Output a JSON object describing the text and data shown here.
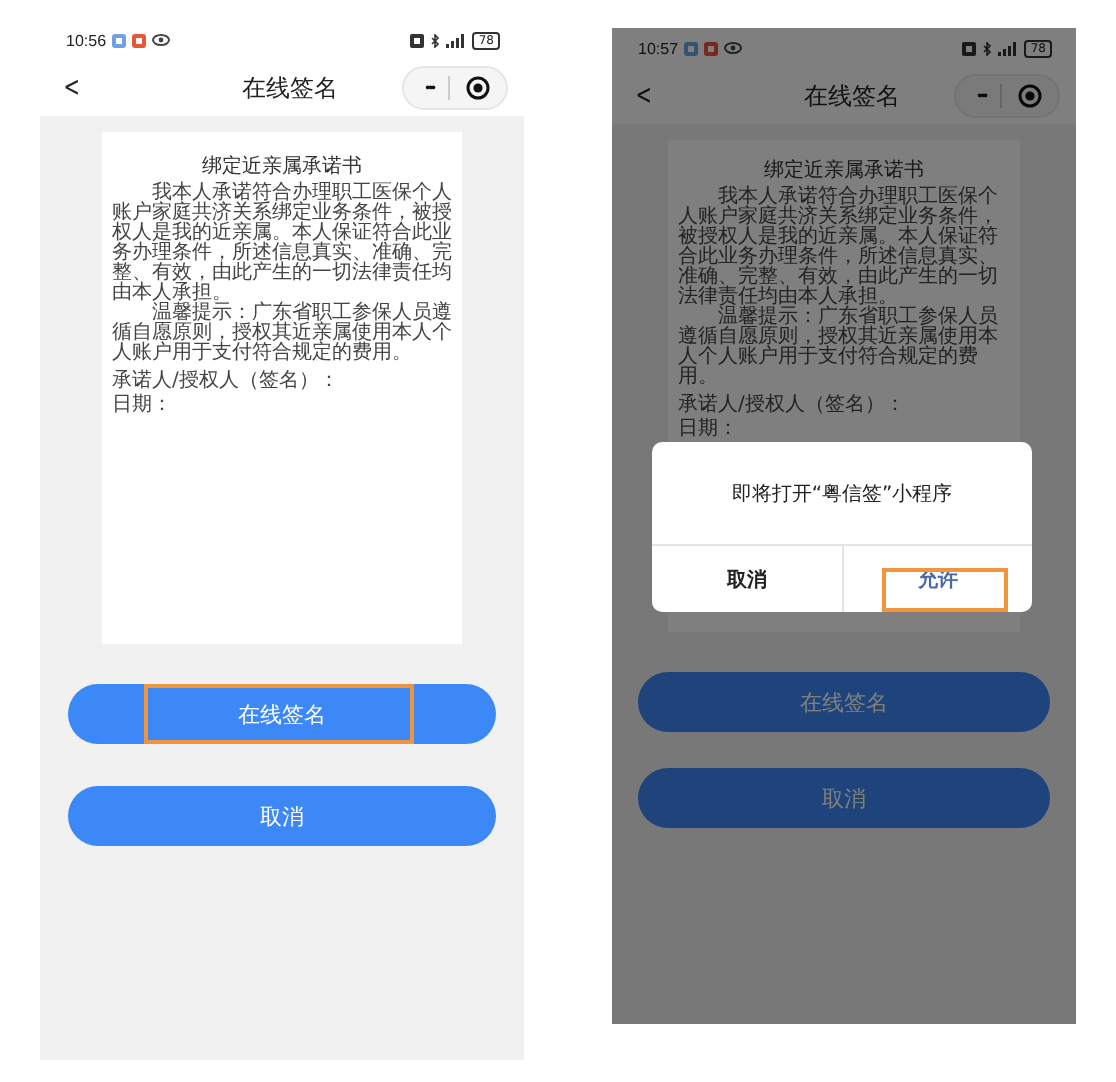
{
  "screens": [
    {
      "status_bar": {
        "time": "10:56",
        "battery": "78"
      },
      "nav_bar": {
        "back": "<",
        "title": "在线签名",
        "menu": "•••"
      },
      "dimmed": false,
      "document": {
        "title": "绑定近亲属承诺书",
        "paragraphs": [
          "我本人承诺符合办理职工医保个人账户家庭共济关系绑定业务条件，被授权人是我的近亲属。本人保证符合此业务办理条件，所述信息真实、准确、完整、有效，由此产生的一切法律责任均由本人承担。",
          "温馨提示：广东省职工参保人员遵循自愿原则，授权其近亲属使用本人个人账户用于支付符合规定的费用。"
        ],
        "signature_line": "承诺人/授权人（签名）：",
        "date_line": "日期："
      },
      "buttons": [
        {
          "label": "在线签名",
          "highlighted": true
        },
        {
          "label": "取消",
          "highlighted": false
        }
      ]
    },
    {
      "status_bar": {
        "time": "10:57",
        "battery": "78"
      },
      "nav_bar": {
        "back": "<",
        "title": "在线签名",
        "menu": "•••"
      },
      "dimmed": true,
      "document": {
        "title": "绑定近亲属承诺书",
        "paragraphs": [
          "我本人承诺符合办理职工医保个人账户家庭共济关系绑定业务条件，被授权人是我的近亲属。本人保证符合此业务办理条件，所述信息真实、准确、完整、有效，由此产生的一切法律责任均由本人承担。",
          "温馨提示：广东省职工参保人员遵循自愿原则，授权其近亲属使用本人个人账户用于支付符合规定的费用。"
        ],
        "signature_line": "承诺人/授权人（签名）：",
        "date_line": "日期："
      },
      "buttons": [
        {
          "label": "在线签名",
          "highlighted": false
        },
        {
          "label": "取消",
          "highlighted": false
        }
      ],
      "dialog": {
        "message": "即将打开“粤信签”小程序",
        "buttons": [
          {
            "label": "取消",
            "kind": "cancel",
            "highlighted": false
          },
          {
            "label": "允许",
            "kind": "confirm",
            "highlighted": true
          }
        ]
      }
    }
  ]
}
